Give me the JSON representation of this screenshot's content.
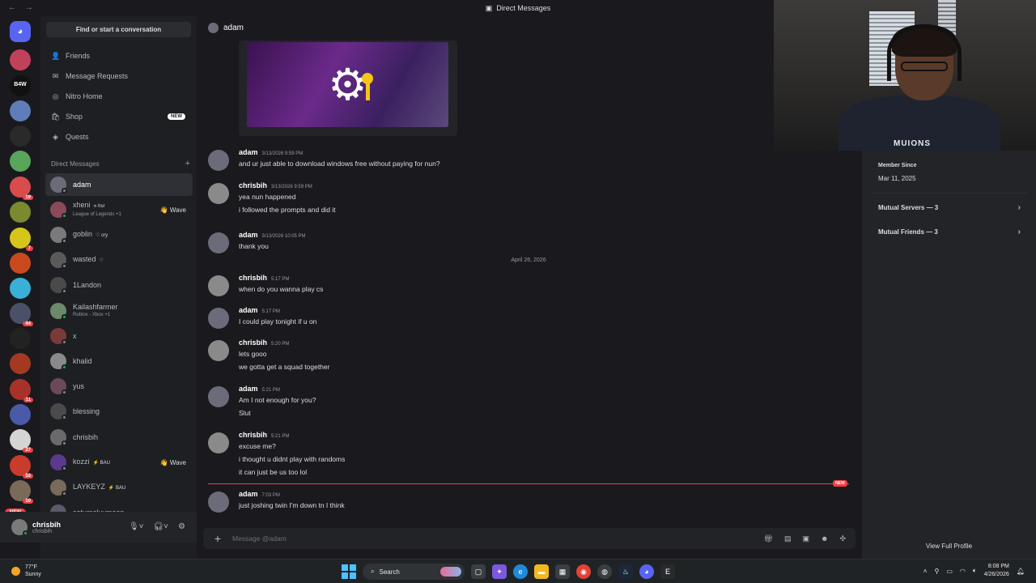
{
  "window": {
    "title": "Direct Messages",
    "nav": "← →"
  },
  "servers": [
    {
      "color": "#5865f2",
      "badge": "",
      "home": true
    },
    {
      "color": "#c2415a",
      "badge": ""
    },
    {
      "color": "#111111",
      "badge": "",
      "text": "B4W"
    },
    {
      "color": "#5f7db8",
      "badge": ""
    },
    {
      "color": "#2a2a2a",
      "badge": ""
    },
    {
      "color": "#58a55c",
      "badge": ""
    },
    {
      "color": "#d84c4c",
      "badge": "19"
    },
    {
      "color": "#7b8a2e",
      "badge": ""
    },
    {
      "color": "#d6c51a",
      "badge": "7"
    },
    {
      "color": "#c94a1e",
      "badge": ""
    },
    {
      "color": "#3ab0d8",
      "badge": ""
    },
    {
      "color": "#4a5068",
      "badge": "44"
    },
    {
      "color": "#222222",
      "badge": ""
    },
    {
      "color": "#a33a20",
      "badge": ""
    },
    {
      "color": "#a8322a",
      "badge": "11"
    },
    {
      "color": "#4a5aa8",
      "badge": ""
    },
    {
      "color": "#d4d4d4",
      "badge": "27"
    },
    {
      "color": "#c93b2a",
      "badge": "53"
    },
    {
      "color": "#7b6a58",
      "badge": "10"
    }
  ],
  "rail_new": "NEW",
  "sidebar": {
    "find": "Find or start a conversation",
    "nav": [
      {
        "label": "Friends",
        "icon": "👤"
      },
      {
        "label": "Message Requests",
        "icon": "✉"
      },
      {
        "label": "Nitro Home",
        "icon": "◎"
      },
      {
        "label": "Shop",
        "icon": "🛍",
        "badge": "NEW"
      },
      {
        "label": "Quests",
        "icon": "◈"
      }
    ],
    "dm_header": "Direct Messages",
    "dm_add": "+",
    "dms": [
      {
        "name": "adam",
        "sub": "",
        "tag": "",
        "wave": "",
        "color": "#6b6b7a",
        "status": "#80848e"
      },
      {
        "name": "xheni",
        "sub": "League of Legends +1",
        "tag": "⟡ hsr",
        "wave": "👋 Wave",
        "color": "#8a4a5a",
        "status": "#23a55a"
      },
      {
        "name": "goblin",
        "sub": "",
        "tag": "♡ cry",
        "wave": "",
        "color": "#7a7a7a",
        "status": "#80848e"
      },
      {
        "name": "wasted",
        "sub": "",
        "tag": "♡",
        "wave": "",
        "color": "#5a5a5a",
        "status": "#80848e"
      },
      {
        "name": "1Landon",
        "sub": "",
        "tag": "",
        "wave": "",
        "color": "#4a4a4a",
        "status": "#80848e"
      },
      {
        "name": "Kailashfarmer",
        "sub": "Roblox - Xbox +1",
        "tag": "",
        "wave": "",
        "color": "#6a8a6a",
        "status": "#23a55a"
      },
      {
        "name": "x",
        "sub": "",
        "tag": "",
        "wave": "",
        "color": "#7a3a3a",
        "status": "#80848e"
      },
      {
        "name": "khalid",
        "sub": "",
        "tag": "",
        "wave": "",
        "color": "#8a8a8a",
        "status": "#23a55a"
      },
      {
        "name": "yus",
        "sub": "",
        "tag": "",
        "wave": "",
        "color": "#6a4a5a",
        "status": "#80848e"
      },
      {
        "name": "blessing",
        "sub": "",
        "tag": "",
        "wave": "",
        "color": "#4a4a4a",
        "status": "#80848e"
      },
      {
        "name": "chrisbih",
        "sub": "",
        "tag": "",
        "wave": "",
        "color": "#6a6a6a",
        "status": "#80848e"
      },
      {
        "name": "kozzi",
        "sub": "",
        "tag": "⚡ BAU",
        "wave": "👋 Wave",
        "color": "#5a3a8a",
        "status": "#80848e"
      },
      {
        "name": "LAYKEYZ",
        "sub": "",
        "tag": "⚡ BAU",
        "wave": "",
        "color": "#7a6a5a",
        "status": "#80848e"
      },
      {
        "name": "saturnsluvmoon",
        "sub": "",
        "tag": "",
        "wave": "",
        "color": "#5a5a6a",
        "status": "#80848e"
      }
    ]
  },
  "user": {
    "name": "chrisbih",
    "tag": "chrisbih"
  },
  "chat": {
    "recipient": "adam",
    "date_separator": "April 26, 2026",
    "new_label": "NEW",
    "composer_placeholder": "Message @adam",
    "messages": [
      {
        "author": "adam",
        "time": "3/13/2026 9:59 PM",
        "lines": [
          "and ur just able to download windows free without paying for nun?"
        ],
        "avatar": "#6b6b7a"
      },
      {
        "author": "chrisbih",
        "time": "3/13/2026 9:59 PM",
        "lines": [
          "yea nun happened",
          "i followed the prompts and did it"
        ],
        "avatar": "#8a8a8a"
      },
      {
        "author": "adam",
        "time": "3/13/2026 10:05 PM",
        "lines": [
          "thank you"
        ],
        "avatar": "#6b6b7a"
      },
      {
        "author": "chrisbih",
        "time": "5:17 PM",
        "lines": [
          "when do you wanna play cs"
        ],
        "avatar": "#8a8a8a"
      },
      {
        "author": "adam",
        "time": "5:17 PM",
        "lines": [
          "I could play tonight if u on"
        ],
        "avatar": "#6b6b7a"
      },
      {
        "author": "chrisbih",
        "time": "5:20 PM",
        "lines": [
          "lets gooo",
          "we gotta get a squad together"
        ],
        "avatar": "#8a8a8a"
      },
      {
        "author": "adam",
        "time": "5:21 PM",
        "lines": [
          "Am I not enough for you?",
          "Slut"
        ],
        "avatar": "#6b6b7a"
      },
      {
        "author": "chrisbih",
        "time": "5:21 PM",
        "lines": [
          "excuse me?",
          "i thought u didnt play with randoms",
          "it can just be us too lol"
        ],
        "avatar": "#8a8a8a"
      },
      {
        "author": "adam",
        "time": "7:03 PM",
        "lines": [
          "just joshing twin I'm down tn I think"
        ],
        "avatar": "#6b6b7a"
      }
    ]
  },
  "profile": {
    "member_since_label": "Member Since",
    "member_since": "Mar 11, 2025",
    "mutual_servers": "Mutual Servers — 3",
    "mutual_friends": "Mutual Friends — 3",
    "view_full": "View Full Profile"
  },
  "webcam": {
    "shirt_text": "MUIONS"
  },
  "taskbar": {
    "temp": "77°F",
    "condition": "Sunny",
    "search": "Search",
    "time": "8:08 PM",
    "date": "4/26/2026"
  }
}
